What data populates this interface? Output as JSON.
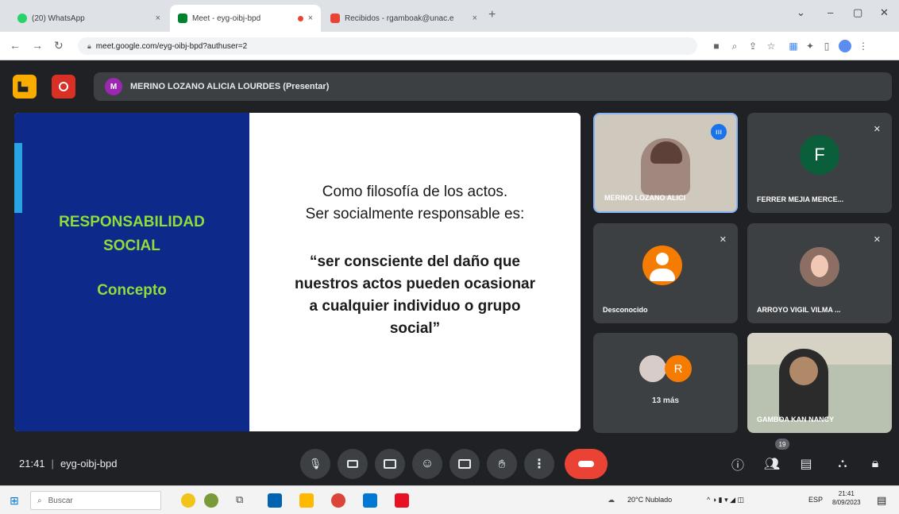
{
  "browser": {
    "tabs": [
      {
        "label": "(20) WhatsApp",
        "close": "×"
      },
      {
        "label": "Meet - eyg-oibj-bpd",
        "close": "×"
      },
      {
        "label": "Recibidos - rgamboak@unac.e",
        "close": "×"
      }
    ],
    "new_tab": "+",
    "url": "meet.google.com/eyg-oibj-bpd?authuser=2"
  },
  "meet": {
    "presenter_initial": "M",
    "presenter_label": "MERINO LOZANO ALICIA LOURDES (Presentar)",
    "slide": {
      "title_line1": "RESPONSABILIDAD",
      "title_line2": "SOCIAL",
      "subtitle": "Concepto",
      "body_line1": "Como filosofía de los actos.",
      "body_line2": "Ser socialmente responsable es:",
      "quote_line1": "“ser consciente del daño que",
      "quote_line2": "nuestros actos pueden ocasionar",
      "quote_line3": "a cualquier individuo o grupo",
      "quote_line4": "social”"
    },
    "participants": [
      {
        "name": "MERINO LOZANO ALICI",
        "speaking": true
      },
      {
        "name": "FERRER MEJIA MERCE...",
        "initial": "F"
      },
      {
        "name": "Desconocido"
      },
      {
        "name": "ARROYO VIGIL VILMA ..."
      },
      {
        "name": "13 más",
        "extra_initial": "R"
      },
      {
        "name": "GAMBOA KAN NANCY"
      }
    ],
    "time": "21:41",
    "meeting_code": "eyg-oibj-bpd",
    "people_badge": "19"
  },
  "taskbar": {
    "search_placeholder": "Buscar",
    "weather": "20°C  Nublado",
    "lang": "ESP",
    "clock_time": "21:41",
    "clock_date": "8/09/2023"
  },
  "colors": {
    "slide_blue": "#0d2a8a",
    "slide_green": "#8fdc3a",
    "end_call": "#ea4335",
    "meet_bg": "#202124"
  }
}
